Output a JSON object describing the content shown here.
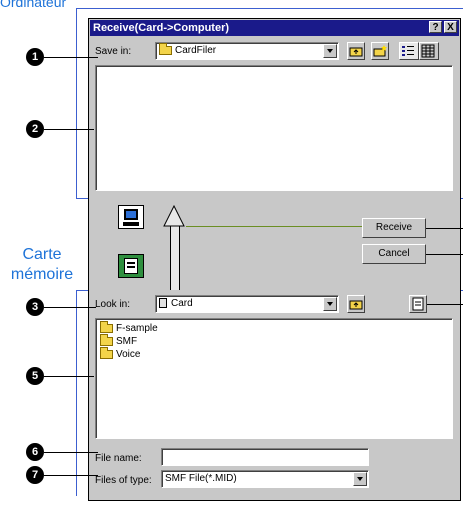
{
  "caption_top": "Ordinateur",
  "caption_side": [
    "Carte",
    "mémoire"
  ],
  "dialog": {
    "title": "Receive(Card->Computer)",
    "help_btn": "?",
    "close_btn": "X"
  },
  "save_in": {
    "label": "Save in:",
    "value": "CardFiler"
  },
  "buttons": {
    "receive": "Receive",
    "cancel": "Cancel"
  },
  "look_in": {
    "label": "Look in:",
    "value": "Card"
  },
  "files": [
    "F-sample",
    "SMF",
    "Voice"
  ],
  "file_name": {
    "label": "File name:",
    "value": ""
  },
  "file_type": {
    "label": "Files of type:",
    "value": "SMF File(*.MID)"
  },
  "callouts": [
    "1",
    "2",
    "3",
    "5",
    "6",
    "7"
  ],
  "colors": {
    "caption_blue": "#1e73d8",
    "title_bar": "#1a1a8a",
    "frame_line": "#3c5fd0"
  }
}
